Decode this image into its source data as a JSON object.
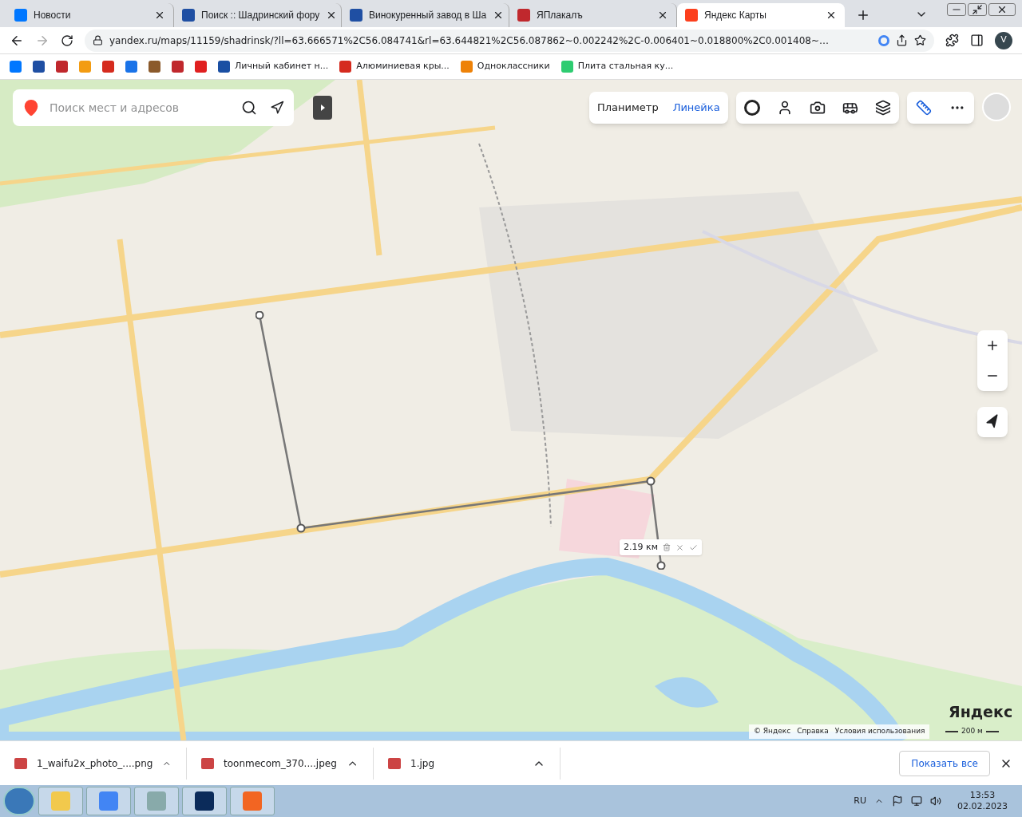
{
  "tabs": [
    {
      "label": "Новости",
      "selected": false
    },
    {
      "label": "Поиск :: Шадринский фору",
      "selected": false
    },
    {
      "label": "Винокуренный завод в Ша",
      "selected": false
    },
    {
      "label": "ЯПлакалъ",
      "selected": false
    },
    {
      "label": "Яндекс Карты",
      "selected": true
    }
  ],
  "address": "yandex.ru/maps/11159/shadrinsk/?ll=63.666571%2C56.084741&rl=63.644821%2C56.087862~0.002242%2C-0.006401~0.018800%2C0.001408~…",
  "profile": "V",
  "bookmarks": [
    {
      "kind": "icon"
    },
    {
      "kind": "icon"
    },
    {
      "kind": "icon"
    },
    {
      "kind": "icon"
    },
    {
      "kind": "icon"
    },
    {
      "kind": "icon"
    },
    {
      "kind": "icon"
    },
    {
      "kind": "icon"
    },
    {
      "kind": "icon"
    },
    {
      "kind": "link",
      "label": "Личный кабинет н..."
    },
    {
      "kind": "link",
      "label": "Алюминиевая кры..."
    },
    {
      "kind": "link",
      "label": "Одноклассники"
    },
    {
      "kind": "link",
      "label": "Плита стальная ку..."
    }
  ],
  "map": {
    "search_placeholder": "Поиск мест и адресов",
    "measure_tabs": [
      {
        "label": "Планиметр",
        "selected": false
      },
      {
        "label": "Линейка",
        "selected": true
      }
    ],
    "distance": "2.19 км",
    "logo": "Яндекс",
    "footer_links": [
      "© Яндекс",
      "Справка",
      "Условия использования"
    ],
    "scale": "200 м"
  },
  "downloads": [
    {
      "name": "1_waifu2x_photo_....png"
    },
    {
      "name": "toonmecom_370....jpeg"
    },
    {
      "name": "1.jpg"
    }
  ],
  "show_all": "Показать все",
  "taskbar": {
    "lang": "RU",
    "time": "13:53",
    "date": "02.02.2023"
  }
}
